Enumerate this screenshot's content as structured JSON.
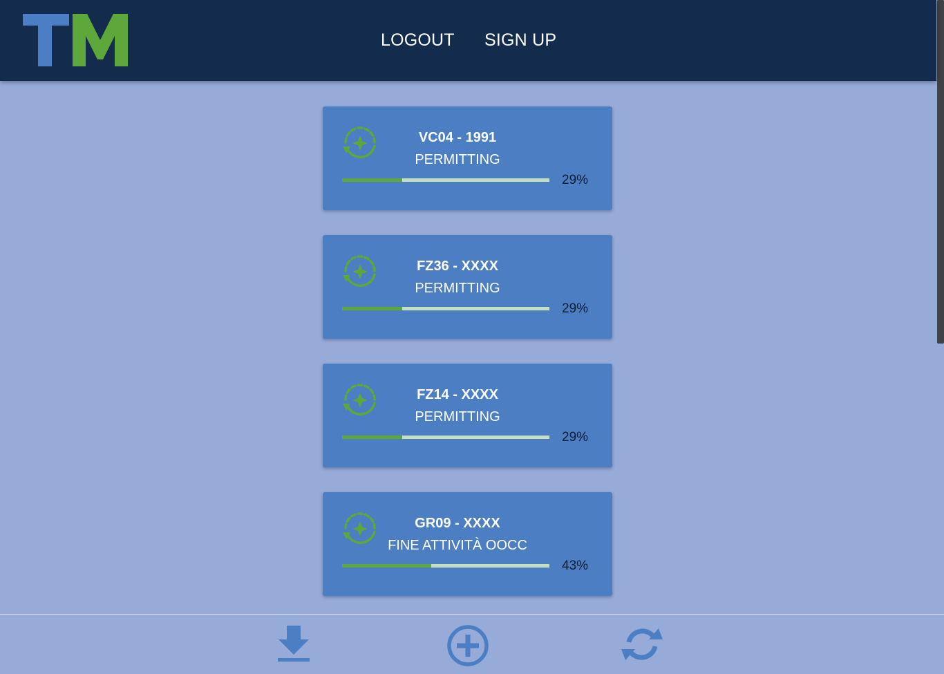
{
  "header": {
    "logo_text": "TM",
    "nav": [
      {
        "label": "LOGOUT"
      },
      {
        "label": "SIGN UP"
      }
    ]
  },
  "cards": [
    {
      "title": "VC04 - 1991",
      "status": "PERMITTING",
      "progress": 0.29,
      "progress_label": "29%"
    },
    {
      "title": "FZ36 - XXXX",
      "status": "PERMITTING",
      "progress": 0.29,
      "progress_label": "29%"
    },
    {
      "title": "FZ14 - XXXX",
      "status": "PERMITTING",
      "progress": 0.29,
      "progress_label": "29%"
    },
    {
      "title": "GR09 - XXXX",
      "status": "FINE ATTIVITÀ OOCC",
      "progress": 0.43,
      "progress_label": "43%"
    }
  ],
  "footer": {
    "buttons": [
      {
        "icon": "download-icon"
      },
      {
        "icon": "add-circle-icon"
      },
      {
        "icon": "refresh-icon"
      }
    ]
  },
  "colors": {
    "header_bg": "#132c4d",
    "page_bg": "#97abd9",
    "card_bg": "#4b7ec2",
    "accent_green": "#5ea83b",
    "logo_blue": "#4b7ec2",
    "progress_track": "#c3dfc0"
  }
}
